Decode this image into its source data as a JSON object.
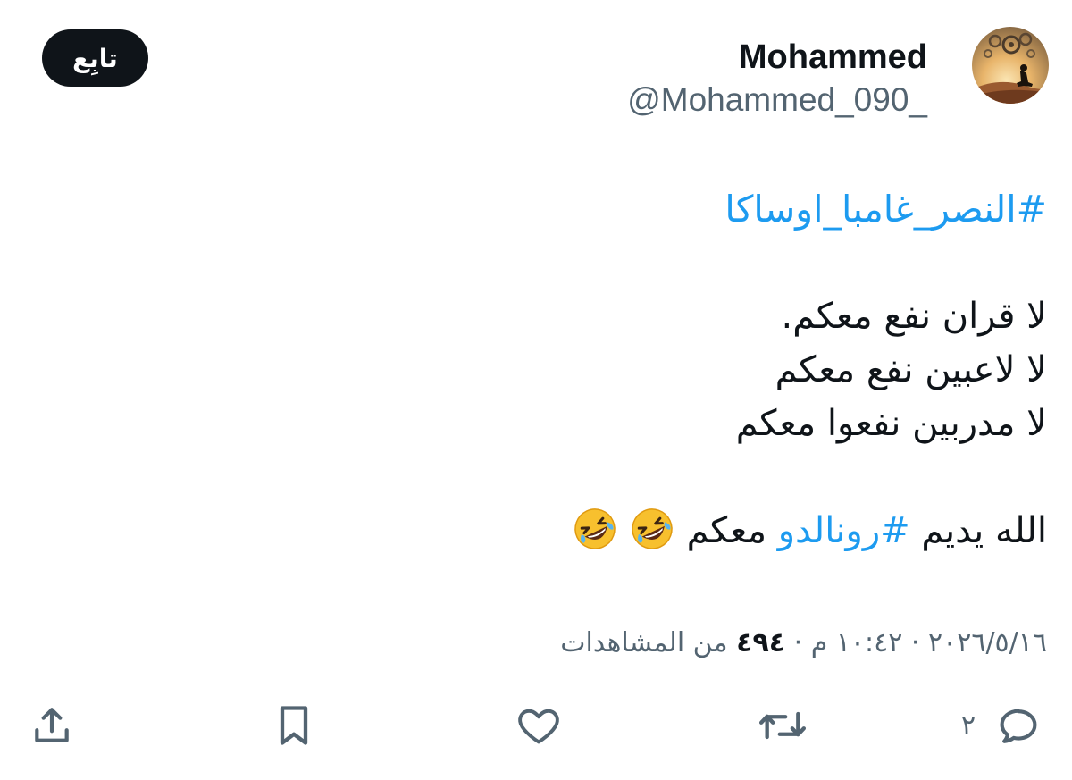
{
  "author": {
    "display_name": "Mohammed",
    "handle": "@Mohammed_090_",
    "avatar_icon": "avatar-person-thinking-gears"
  },
  "follow_button": {
    "label": "تابِع"
  },
  "tweet": {
    "hashtag_main": "#النصر_غامبا_اوساكا",
    "lines": [
      "لا قران نفع معكم.",
      "لا لاعبين نفع معكم",
      "لا مدربين نفعوا معكم"
    ],
    "final_line": {
      "prefix": "الله يديم ",
      "hashtag": "#رونالدو",
      "suffix": " معكم",
      "emoji": "rolling-on-floor-laughing",
      "emoji_count": 2
    }
  },
  "meta": {
    "time": "١٠:٤٢ م",
    "separator": " · ",
    "date": "٢٠٢٦/٥/١٦",
    "views_count": "٤٩٤",
    "views_label": "من المشاهدات"
  },
  "actions": {
    "reply_count": "٢",
    "icons": [
      "reply-icon",
      "retweet-icon",
      "like-icon",
      "bookmark-icon",
      "share-icon"
    ]
  },
  "colors": {
    "text": "#0f1419",
    "secondary": "#536471",
    "link": "#1d9bf0",
    "button_bg": "#0f1419"
  }
}
